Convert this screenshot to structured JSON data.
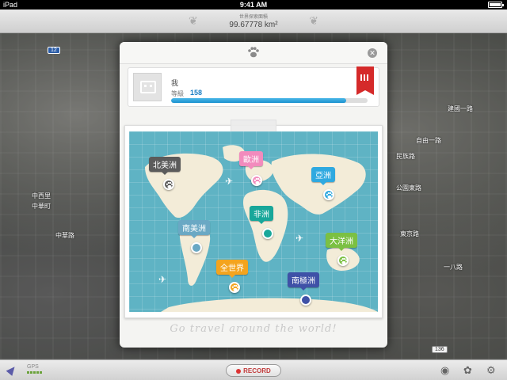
{
  "status_bar": {
    "carrier": "iPad",
    "time": "9:41 AM"
  },
  "header": {
    "label": "世界探索面積",
    "value": "99.67778 km²"
  },
  "map_labels": [
    {
      "text": "中西里"
    },
    {
      "text": "中華路"
    },
    {
      "text": "中華町"
    },
    {
      "text": "建國一路"
    },
    {
      "text": "自由一路"
    },
    {
      "text": "民族路"
    },
    {
      "text": "公園東路"
    },
    {
      "text": "東京路"
    },
    {
      "text": "一八路"
    }
  ],
  "road_badges": [
    "12",
    "136"
  ],
  "dialog": {
    "close_icon": "close-icon",
    "profile": {
      "name": "我",
      "level_label": "等級",
      "level_value": "158",
      "progress": 0.89,
      "ribbon_icon": "city-ribbon-icon"
    },
    "continents": [
      {
        "label": "北美洲",
        "color": "#5b5b5b",
        "pin_color": "#5b5b5b",
        "paw": true
      },
      {
        "label": "歐洲",
        "color": "#f28bbd",
        "pin_color": "#f28bbd",
        "paw": true
      },
      {
        "label": "亞洲",
        "color": "#2fa9e0",
        "pin_color": "#2fa9e0",
        "paw": true
      },
      {
        "label": "非洲",
        "color": "#18a79a",
        "pin_color": "#18a79a",
        "paw": false
      },
      {
        "label": "南美洲",
        "color": "#6aa8c4",
        "pin_color": "#6aa8c4",
        "paw": false
      },
      {
        "label": "大洋洲",
        "color": "#7bc043",
        "pin_color": "#7bc043",
        "paw": true
      },
      {
        "label": "全世界",
        "color": "#f4a41e",
        "pin_color": "#f4a41e",
        "paw": true
      },
      {
        "label": "南極洲",
        "color": "#3f51a7",
        "pin_color": "#3f51a7",
        "paw": false
      }
    ],
    "slogan": "Go travel around the world!"
  },
  "bottom_bar": {
    "gps_label": "GPS",
    "record_label": "RECORD"
  }
}
